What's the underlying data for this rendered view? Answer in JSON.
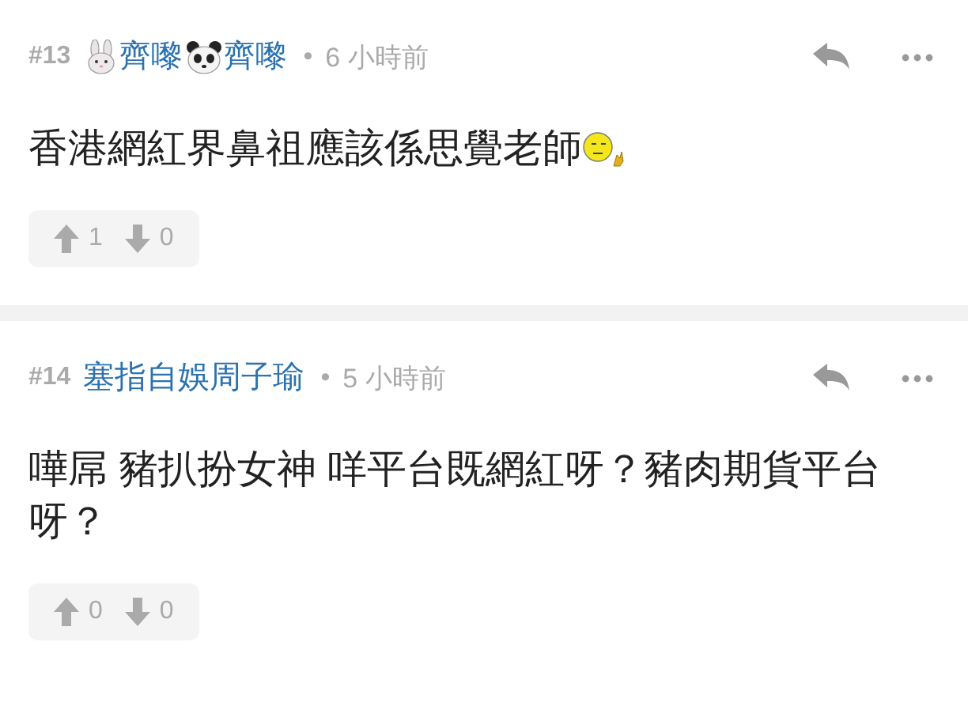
{
  "posts": [
    {
      "number": "#13",
      "author_parts": [
        {
          "kind": "rabbit"
        },
        {
          "kind": "text",
          "text": "齊嚟"
        },
        {
          "kind": "panda"
        },
        {
          "kind": "text",
          "text": "齊嚟"
        }
      ],
      "separator": "•",
      "time": "6 小時前",
      "body_parts": [
        {
          "kind": "text",
          "text": "香港網紅界鼻祖應該係思覺老師"
        },
        {
          "kind": "emoticon"
        }
      ],
      "upvotes": "1",
      "downvotes": "0"
    },
    {
      "number": "#14",
      "author_parts": [
        {
          "kind": "text",
          "text": "塞指自娛周子瑜"
        }
      ],
      "separator": "•",
      "time": "5 小時前",
      "body_parts": [
        {
          "kind": "text",
          "text": "嘩屌 豬扒扮女神 咩平台既網紅呀？豬肉期貨平台呀？"
        }
      ],
      "upvotes": "0",
      "downvotes": "0"
    }
  ]
}
